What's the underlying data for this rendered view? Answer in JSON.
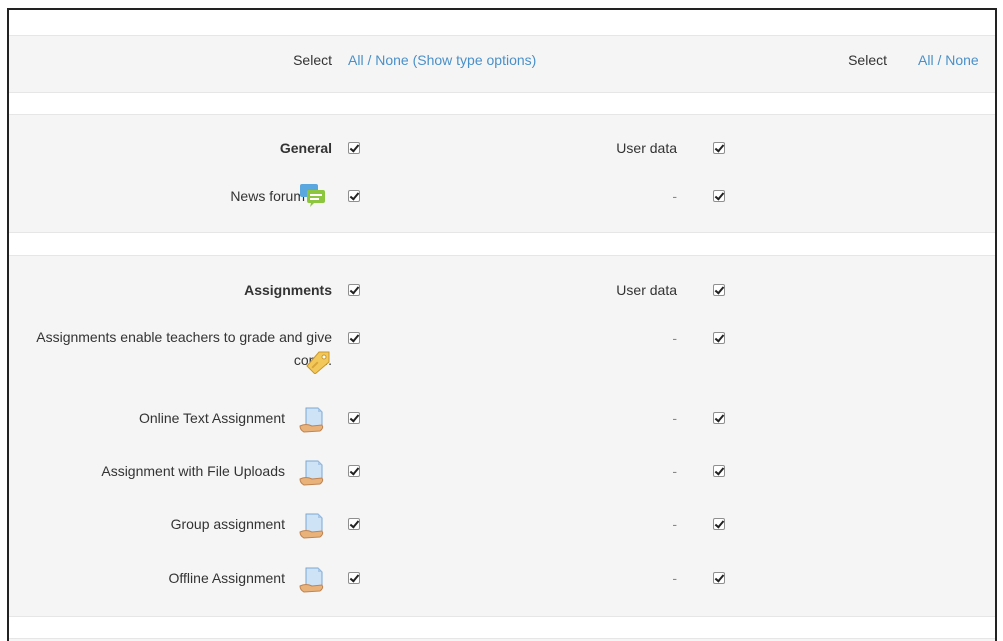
{
  "select_row": {
    "left_label": "Select",
    "left_all_none": "All / None",
    "left_show_type": "(Show type options)",
    "right_label": "Select",
    "right_all_none": "All / None"
  },
  "general": {
    "title": "General",
    "userdata_label": "User data",
    "items": [
      {
        "label": "News forum",
        "icon": "forum-icon",
        "right": "-"
      }
    ]
  },
  "assignments": {
    "title": "Assignments",
    "userdata_label": "User data",
    "items": [
      {
        "label": "Assignments enable teachers to grade and give com...",
        "icon": "assignment-tag-icon",
        "right": "-"
      },
      {
        "label": "Online Text Assignment",
        "icon": "document-hand-icon",
        "right": "-"
      },
      {
        "label": "Assignment with File Uploads",
        "icon": "document-hand-icon",
        "right": "-"
      },
      {
        "label": "Group assignment",
        "icon": "document-hand-icon",
        "right": "-"
      },
      {
        "label": "Offline Assignment",
        "icon": "document-hand-icon",
        "right": "-"
      }
    ]
  }
}
